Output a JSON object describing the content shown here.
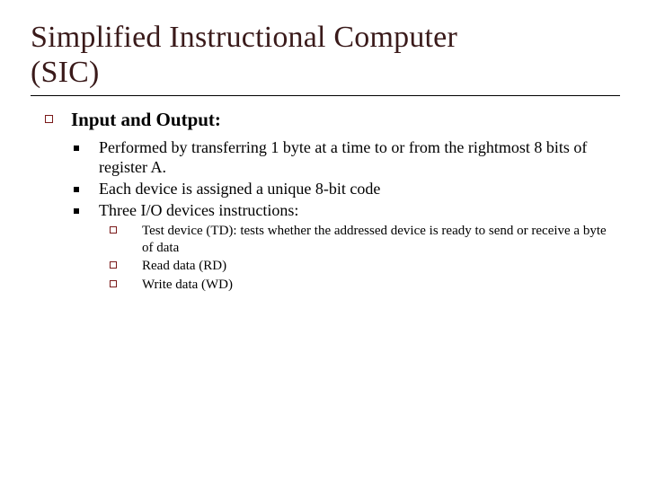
{
  "title_line1": "Simplified Instructional Computer",
  "title_line2": "(SIC)",
  "section": {
    "heading": "Input and Output:",
    "items": [
      "Performed by transferring 1 byte at a time to or from the rightmost 8 bits of register A.",
      "Each device is assigned a unique 8-bit code",
      "Three I/O devices instructions:"
    ],
    "subitems": [
      "Test device (TD): tests whether the addressed device is ready to send or receive a byte of data",
      "Read data (RD)",
      "Write data (WD)"
    ]
  }
}
